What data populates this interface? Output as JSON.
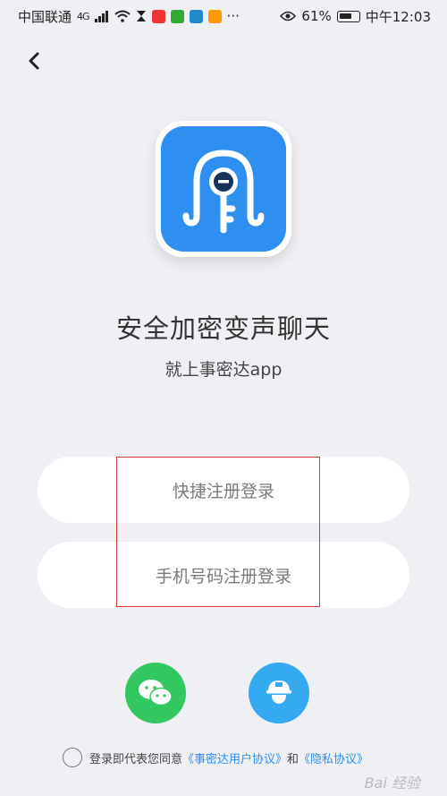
{
  "status_bar": {
    "carrier": "中国联通",
    "network": "4G",
    "more": "···",
    "battery": "61%",
    "time": "中午12:03"
  },
  "hero": {
    "headline": "安全加密变声聊天",
    "subline": "就上事密达app"
  },
  "buttons": {
    "quick_register": "快捷注册登录",
    "phone_register": "手机号码注册登录"
  },
  "agreement": {
    "prefix": "登录即代表您同意",
    "user_agreement": "《事密达用户协议》",
    "and": "和",
    "privacy_policy": "《隐私协议》"
  },
  "watermark": "Bai 经验",
  "colors": {
    "accent": "#2f8ff0",
    "wechat": "#33c760",
    "guest": "#35aaf0",
    "highlight": "#d43a3a"
  },
  "icons": {
    "back": "chevron-left-icon",
    "wechat": "wechat-icon",
    "guest": "guest-helmet-icon",
    "logo": "keyhole-octopus-logo"
  }
}
